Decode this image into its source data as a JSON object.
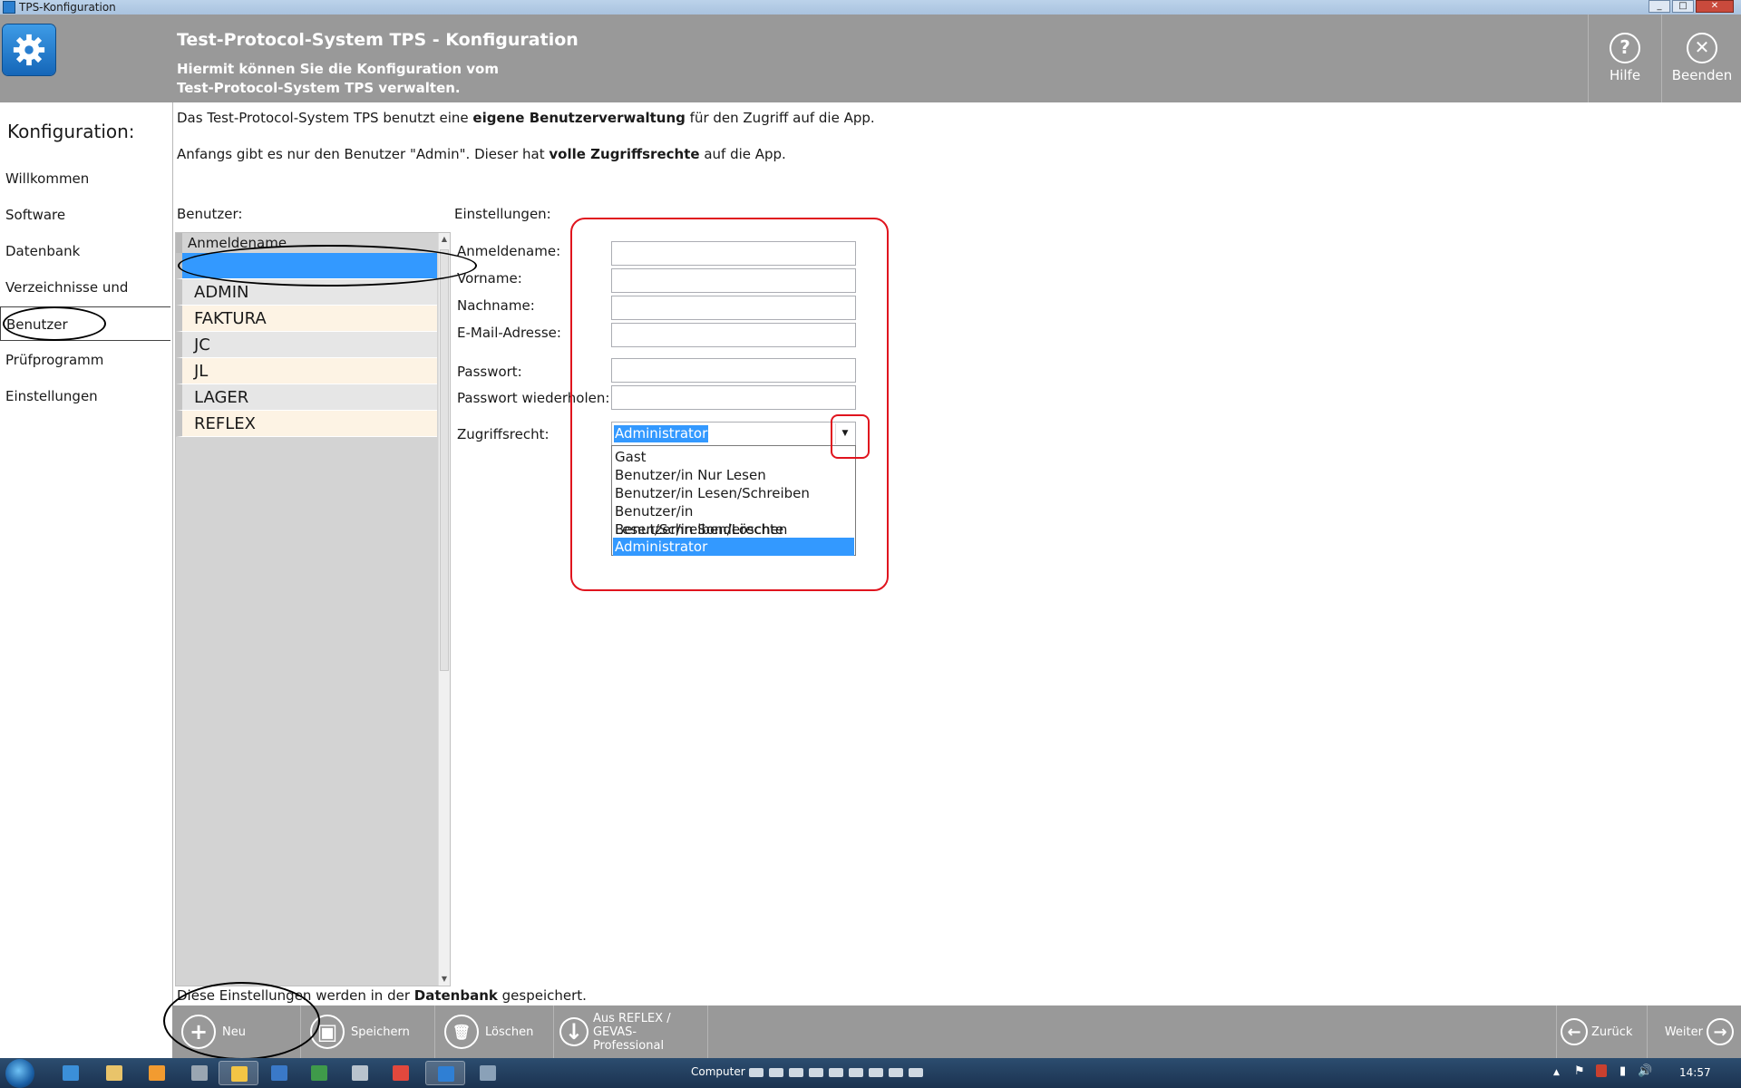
{
  "window": {
    "title": "TPS-Konfiguration",
    "min_glyph": "_",
    "max_glyph": "□",
    "close_glyph": "✕"
  },
  "header": {
    "title": "Test-Protocol-System TPS - Konfiguration",
    "subtitle_line1": "Hiermit können Sie die Konfiguration vom",
    "subtitle_line2": "Test-Protocol-System TPS verwalten.",
    "help": {
      "label": "Hilfe",
      "icon": "question-icon",
      "glyph": "?"
    },
    "exit": {
      "label": "Beenden",
      "icon": "close-icon",
      "glyph": "✕"
    }
  },
  "nav": {
    "title": "Konfiguration:",
    "items": [
      {
        "label": "Willkommen",
        "active": false
      },
      {
        "label": "Software",
        "active": false
      },
      {
        "label": "Datenbank",
        "active": false
      },
      {
        "label": "Verzeichnisse und Ordner",
        "active": false
      },
      {
        "label": "Benutzer",
        "active": true
      },
      {
        "label": "Prüfprogramm",
        "active": false
      },
      {
        "label": "Einstellungen",
        "active": false
      }
    ]
  },
  "intro": {
    "line1_a": "Das Test-Protocol-System TPS benutzt eine ",
    "line1_b": "eigene Benutzerverwaltung",
    "line1_c": " für den Zugriff auf die App.",
    "line2_a": "Anfangs gibt es nur den Benutzer \"Admin\". Dieser hat ",
    "line2_b": "volle Zugriffsrechte",
    "line2_c": " auf die App."
  },
  "users": {
    "label": "Benutzer:",
    "column_header": "Anmeldename",
    "rows": [
      "",
      "ADMIN",
      "FAKTURA",
      "JC",
      "JL",
      "LAGER",
      "REFLEX"
    ],
    "selected_index": 0
  },
  "settings": {
    "label": "Einstellungen:",
    "fields": {
      "username": {
        "label": "Anmeldename:",
        "value": ""
      },
      "firstname": {
        "label": "Vorname:",
        "value": ""
      },
      "lastname": {
        "label": "Nachname:",
        "value": ""
      },
      "email": {
        "label": "E-Mail-Adresse:",
        "value": ""
      },
      "password": {
        "label": "Passwort:",
        "value": ""
      },
      "password_repeat": {
        "label": "Passwort wiederholen:",
        "value": ""
      }
    },
    "access": {
      "label": "Zugriffsrecht:",
      "selected": "Administrator",
      "options": [
        "Gast",
        "Benutzer/in Nur Lesen",
        "Benutzer/in Lesen/Schreiben",
        "Benutzer/in Lesen/Schreiben/Löschen",
        "Benutzer/in Sonderechte",
        "Administrator"
      ],
      "highlighted_index": 5
    }
  },
  "footer_note": {
    "a": "Diese Einstellungen werden in der ",
    "b": "Datenbank",
    "c": " gespeichert."
  },
  "appbar": {
    "new": {
      "label": "Neu",
      "icon": "plus-icon",
      "glyph": "+"
    },
    "save": {
      "label": "Speichern",
      "icon": "floppy-icon",
      "glyph": "▣"
    },
    "delete": {
      "label": "Löschen",
      "icon": "trash-icon",
      "glyph": "🗑"
    },
    "import_line1": "Aus REFLEX /",
    "import_line2": "GEVAS-Professional",
    "import_icon": {
      "icon": "download-icon",
      "glyph": "↓"
    },
    "back": {
      "label": "Zurück",
      "icon": "arrow-left-icon",
      "glyph": "←"
    },
    "next": {
      "label": "Weiter",
      "icon": "arrow-right-icon",
      "glyph": "→"
    }
  },
  "taskbar": {
    "computer_label": "Computer",
    "clock": "14:57",
    "tray_symbols": {
      "arrow": "▲",
      "flag": "⚑",
      "signal": "▮",
      "volume": "🔊"
    },
    "apps": [
      {
        "name": "ie-icon",
        "color": "#3b8fd8",
        "active": false
      },
      {
        "name": "explorer-icon",
        "color": "#e9c46a",
        "active": false
      },
      {
        "name": "media-icon",
        "color": "#f29b30",
        "active": false
      },
      {
        "name": "tool-icon",
        "color": "#9aa6b2",
        "active": false
      },
      {
        "name": "folder-icon",
        "color": "#f3c545",
        "active": true
      },
      {
        "name": "app-icon",
        "color": "#3a79c8",
        "active": false
      },
      {
        "name": "excel-icon",
        "color": "#3f9a4a",
        "active": false
      },
      {
        "name": "calc-icon",
        "color": "#b9c3cd",
        "active": false
      },
      {
        "name": "chrome-icon",
        "color": "#e2483d",
        "active": false
      },
      {
        "name": "tps-icon",
        "color": "#2f7fd4",
        "active": true
      },
      {
        "name": "remote-icon",
        "color": "#8aa1b8",
        "active": false
      }
    ]
  }
}
